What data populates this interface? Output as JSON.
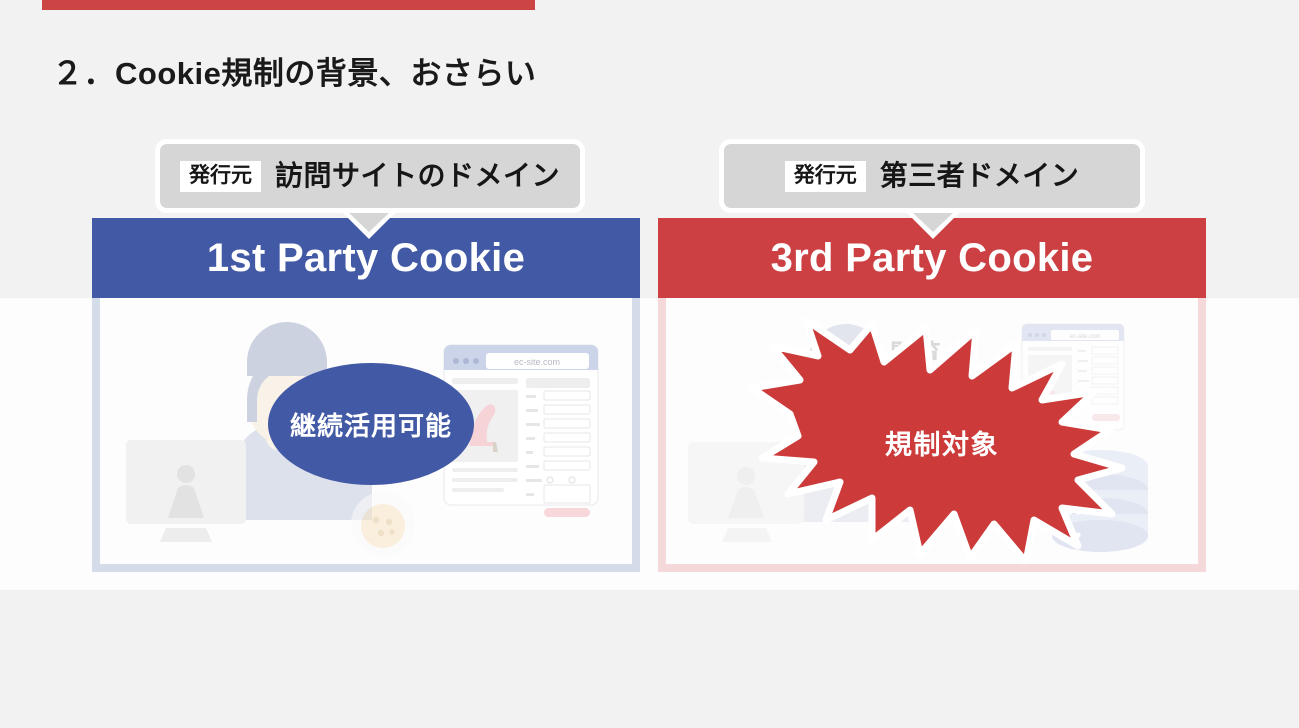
{
  "slide": {
    "title": "２．Cookie規制の背景、おさらい",
    "accent_red": "#cc4444",
    "accent_blue": "#4259a5",
    "background": "#f2f2f2"
  },
  "columns": [
    {
      "id": "first-party",
      "bubble": {
        "chip_label": "発行元",
        "text": "訪問サイトのドメイン"
      },
      "header": {
        "title": "1st Party Cookie",
        "color": "#4259a5"
      },
      "badge": {
        "text": "継続活用可能",
        "shape": "ellipse",
        "color": "#4259a5"
      },
      "illustration": {
        "browser_url": "ec-site.com",
        "alt": "person-at-desktop-viewing-ec-site"
      },
      "border_color": "#d4dcea"
    },
    {
      "id": "third-party",
      "bubble": {
        "chip_label": "発行元",
        "text": "第三者ドメイン"
      },
      "header": {
        "title": "3rd Party Cookie",
        "color": "#cc4044"
      },
      "badge": {
        "text": "規制対象",
        "shape": "starburst",
        "color": "#cc3a3a"
      },
      "illustration": {
        "browser_url": "ec-site.com",
        "overlay_label": "閲覧",
        "alt": "person-browsing-with-third-party-data-server"
      },
      "border_color": "#f4d8da"
    }
  ]
}
